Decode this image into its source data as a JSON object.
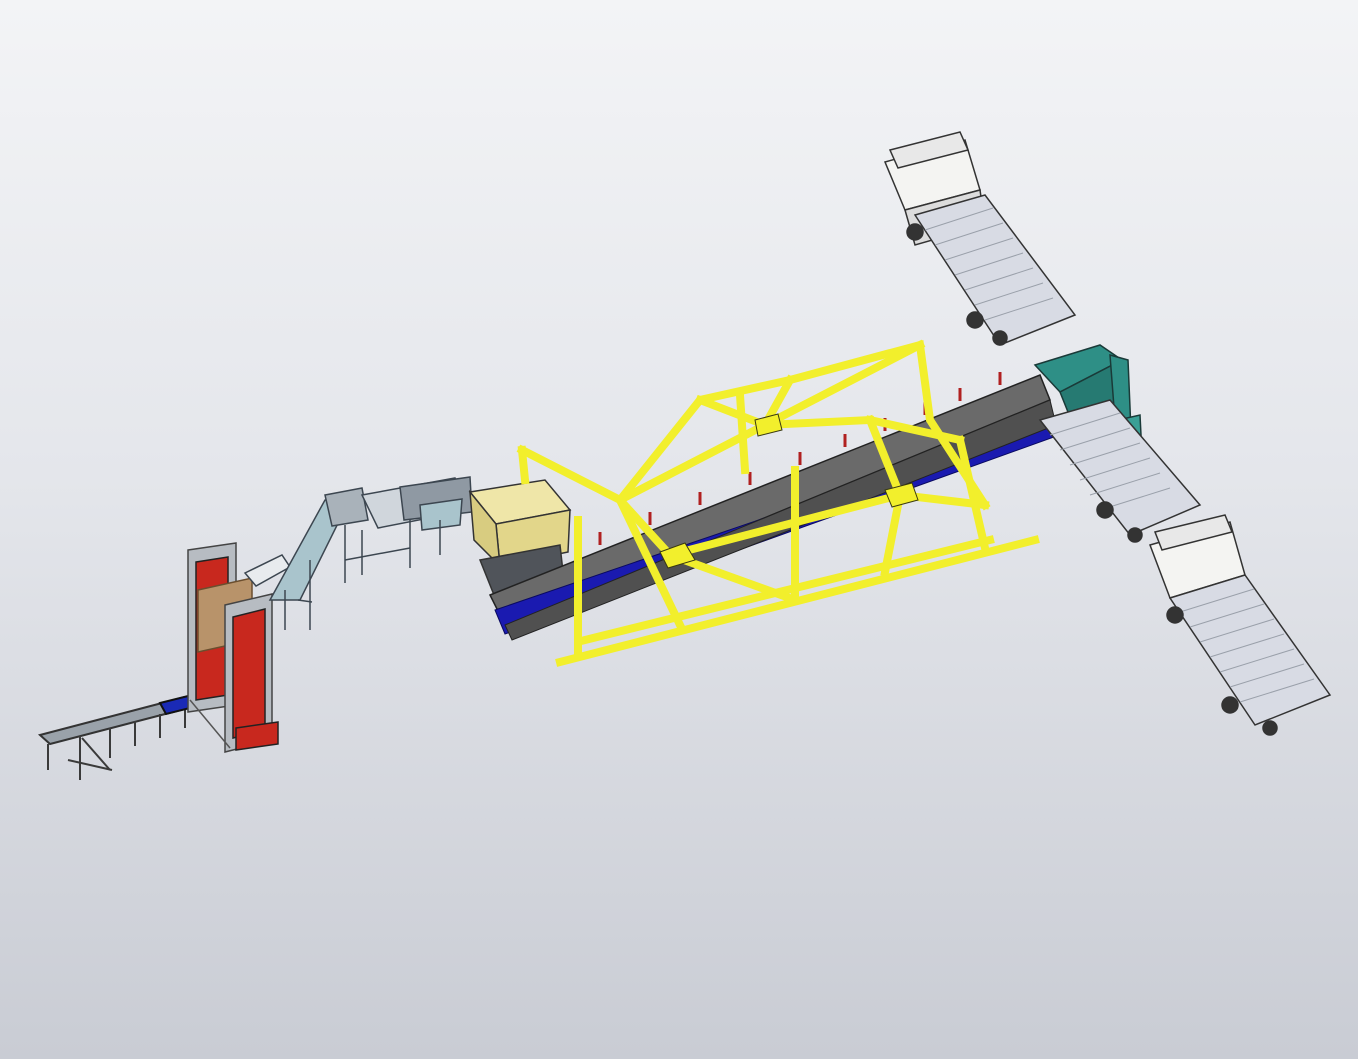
{
  "viewport": {
    "background_top": "#f3f4f6",
    "background_bottom": "#c9ccd4"
  },
  "colors": {
    "truss_yellow": "#f2ef2c",
    "conveyor_blue": "#1a1ab0",
    "belt_gray": "#6a6a6a",
    "loader_teal": "#2e8f86",
    "bin_red": "#c8281e",
    "steel_gray": "#a9b2ba",
    "hopper_tan": "#efe6a8",
    "truck_white": "#f4f4f2",
    "truck_bed": "#d8dbe4"
  },
  "components": [
    "feed-roller-conveyor",
    "stacking-tower",
    "incline-chain-conveyor",
    "screen-unit",
    "feed-hopper",
    "yellow-truss-frame",
    "main-belt-conveyor",
    "truck-loading-chute",
    "flatbed-truck-1",
    "flatbed-truck-2",
    "flatbed-truck-3"
  ]
}
